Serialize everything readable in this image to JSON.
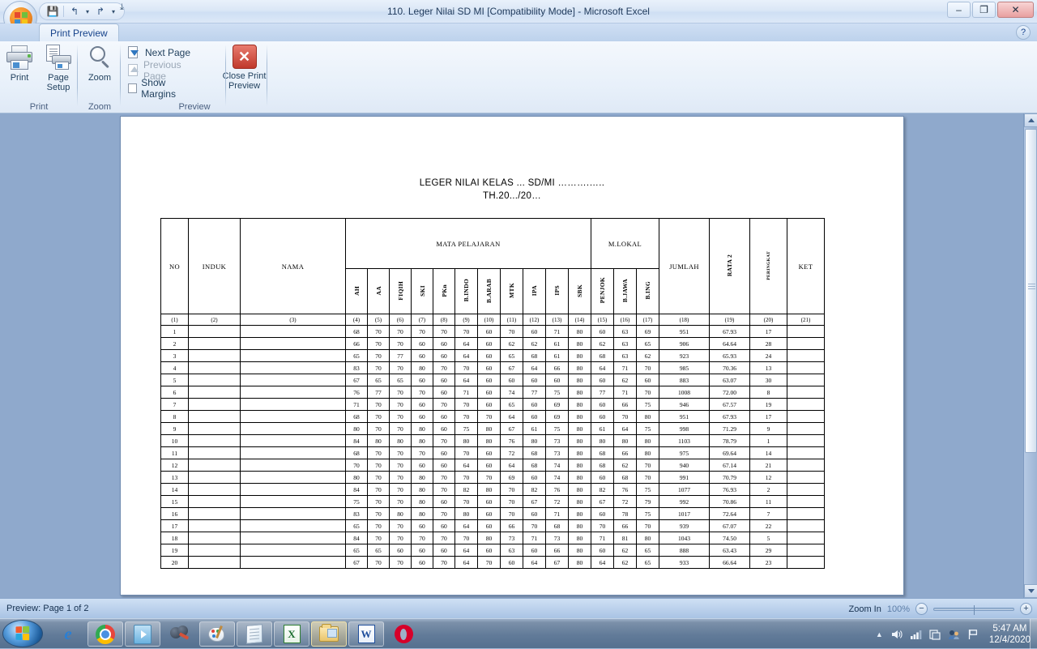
{
  "window": {
    "title": "110. Leger Nilai SD MI  [Compatibility Mode] - Microsoft Excel",
    "minimize": "–",
    "maximize": "❐",
    "close": "✕",
    "help": "?"
  },
  "quick_access": {
    "save_icon": "save-icon",
    "undo_icon": "undo-icon",
    "redo_icon": "redo-icon",
    "customize_icon": "customize-icon",
    "save_glyph": "💾",
    "undo_glyph": "↰",
    "redo_glyph": "↱",
    "dropdown_glyph": "▾",
    "more_glyph": "⤓"
  },
  "ribbon": {
    "tab": "Print Preview",
    "groups": [
      {
        "name": "Print",
        "label": "Print",
        "buttons": [
          {
            "label": "Print",
            "icon": "printer-icon"
          },
          {
            "label": "Page\nSetup",
            "label_line1": "Page",
            "label_line2": "Setup",
            "icon": "page-setup-icon"
          }
        ]
      },
      {
        "name": "Zoom",
        "label": "Zoom",
        "buttons": [
          {
            "label": "Zoom",
            "icon": "magnifier-icon"
          }
        ]
      },
      {
        "name": "Preview",
        "label": "Preview",
        "items": [
          {
            "label": "Next Page",
            "icon": "next-page-icon",
            "enabled": true
          },
          {
            "label": "Previous Page",
            "icon": "previous-page-icon",
            "enabled": false
          },
          {
            "label": "Show Margins",
            "icon": "checkbox-icon",
            "checked": false
          }
        ],
        "close_button": {
          "label_line1": "Close Print",
          "label_line2": "Preview",
          "icon": "close-x-icon",
          "glyph": "✕"
        }
      }
    ]
  },
  "document": {
    "title_line1": "LEGER NILAI KELAS ... SD/MI ……….…..",
    "title_line2": "TH.20.../20…",
    "table": {
      "group_headers": {
        "no": "NO",
        "induk": "INDUK",
        "nama": "NAMA",
        "mata_pelajaran": "MATA PELAJARAN",
        "m_lokal": "M.LOKAL",
        "jumlah": "JUMLAH",
        "rata2": "RATA 2",
        "peringkat": "PERINGKAT",
        "ket": "KET"
      },
      "subject_headers": [
        "AH",
        "AA",
        "FIQIH",
        "SKI",
        "PKn",
        "B.INDO",
        "B.ARAB",
        "MTK",
        "IPA",
        "IPS",
        "SBK"
      ],
      "local_headers": [
        "PENJOK",
        "B.JAWA",
        "B.ING"
      ],
      "number_row": [
        "(1)",
        "(2)",
        "(3)",
        "(4)",
        "(5)",
        "(6)",
        "(7)",
        "(8)",
        "(9)",
        "(10)",
        "(11)",
        "(12)",
        "(13)",
        "(14)",
        "(15)",
        "(16)",
        "(17)",
        "(18)",
        "(19)",
        "(20)",
        "(21)"
      ],
      "rows": [
        {
          "no": "1",
          "induk": "",
          "nama": "",
          "scores": [
            "68",
            "70",
            "70",
            "70",
            "70",
            "70",
            "60",
            "70",
            "60",
            "71",
            "80",
            "60",
            "63",
            "69"
          ],
          "jumlah": "951",
          "rata2": "67.93",
          "peringkat": "17",
          "ket": ""
        },
        {
          "no": "2",
          "induk": "",
          "nama": "",
          "scores": [
            "66",
            "70",
            "70",
            "60",
            "60",
            "64",
            "60",
            "62",
            "62",
            "61",
            "80",
            "62",
            "63",
            "65"
          ],
          "jumlah": "906",
          "rata2": "64.64",
          "peringkat": "28",
          "ket": ""
        },
        {
          "no": "3",
          "induk": "",
          "nama": "",
          "scores": [
            "65",
            "70",
            "77",
            "60",
            "60",
            "64",
            "60",
            "65",
            "68",
            "61",
            "80",
            "68",
            "63",
            "62"
          ],
          "jumlah": "923",
          "rata2": "65.93",
          "peringkat": "24",
          "ket": ""
        },
        {
          "no": "4",
          "induk": "",
          "nama": "",
          "scores": [
            "83",
            "70",
            "70",
            "80",
            "70",
            "70",
            "60",
            "67",
            "64",
            "66",
            "80",
            "64",
            "71",
            "70"
          ],
          "jumlah": "985",
          "rata2": "70.36",
          "peringkat": "13",
          "ket": ""
        },
        {
          "no": "5",
          "induk": "",
          "nama": "",
          "scores": [
            "67",
            "65",
            "65",
            "60",
            "60",
            "64",
            "60",
            "60",
            "60",
            "60",
            "80",
            "60",
            "62",
            "60"
          ],
          "jumlah": "883",
          "rata2": "63.07",
          "peringkat": "30",
          "ket": ""
        },
        {
          "no": "6",
          "induk": "",
          "nama": "",
          "scores": [
            "76",
            "77",
            "70",
            "70",
            "60",
            "71",
            "60",
            "74",
            "77",
            "75",
            "80",
            "77",
            "71",
            "70"
          ],
          "jumlah": "1008",
          "rata2": "72.00",
          "peringkat": "8",
          "ket": ""
        },
        {
          "no": "7",
          "induk": "",
          "nama": "",
          "scores": [
            "71",
            "70",
            "70",
            "60",
            "70",
            "70",
            "60",
            "65",
            "60",
            "69",
            "80",
            "60",
            "66",
            "75"
          ],
          "jumlah": "946",
          "rata2": "67.57",
          "peringkat": "19",
          "ket": ""
        },
        {
          "no": "8",
          "induk": "",
          "nama": "",
          "scores": [
            "68",
            "70",
            "70",
            "60",
            "60",
            "70",
            "70",
            "64",
            "60",
            "69",
            "80",
            "60",
            "70",
            "80"
          ],
          "jumlah": "951",
          "rata2": "67.93",
          "peringkat": "17",
          "ket": ""
        },
        {
          "no": "9",
          "induk": "",
          "nama": "",
          "scores": [
            "80",
            "70",
            "70",
            "80",
            "60",
            "75",
            "80",
            "67",
            "61",
            "75",
            "80",
            "61",
            "64",
            "75"
          ],
          "jumlah": "998",
          "rata2": "71.29",
          "peringkat": "9",
          "ket": ""
        },
        {
          "no": "10",
          "induk": "",
          "nama": "",
          "scores": [
            "84",
            "80",
            "80",
            "80",
            "70",
            "80",
            "80",
            "76",
            "80",
            "73",
            "80",
            "80",
            "80",
            "80"
          ],
          "jumlah": "1103",
          "rata2": "78.79",
          "peringkat": "1",
          "ket": ""
        },
        {
          "no": "11",
          "induk": "",
          "nama": "",
          "scores": [
            "68",
            "70",
            "70",
            "70",
            "60",
            "70",
            "60",
            "72",
            "68",
            "73",
            "80",
            "68",
            "66",
            "80"
          ],
          "jumlah": "975",
          "rata2": "69.64",
          "peringkat": "14",
          "ket": ""
        },
        {
          "no": "12",
          "induk": "",
          "nama": "",
          "scores": [
            "70",
            "70",
            "70",
            "60",
            "60",
            "64",
            "60",
            "64",
            "68",
            "74",
            "80",
            "68",
            "62",
            "70"
          ],
          "jumlah": "940",
          "rata2": "67.14",
          "peringkat": "21",
          "ket": ""
        },
        {
          "no": "13",
          "induk": "",
          "nama": "",
          "scores": [
            "80",
            "70",
            "70",
            "80",
            "70",
            "70",
            "70",
            "69",
            "60",
            "74",
            "80",
            "60",
            "68",
            "70"
          ],
          "jumlah": "991",
          "rata2": "70.79",
          "peringkat": "12",
          "ket": ""
        },
        {
          "no": "14",
          "induk": "",
          "nama": "",
          "scores": [
            "84",
            "70",
            "70",
            "80",
            "70",
            "82",
            "80",
            "70",
            "82",
            "76",
            "80",
            "82",
            "76",
            "75"
          ],
          "jumlah": "1077",
          "rata2": "76.93",
          "peringkat": "2",
          "ket": ""
        },
        {
          "no": "15",
          "induk": "",
          "nama": "",
          "scores": [
            "75",
            "70",
            "70",
            "80",
            "60",
            "70",
            "60",
            "70",
            "67",
            "72",
            "80",
            "67",
            "72",
            "79"
          ],
          "jumlah": "992",
          "rata2": "70.86",
          "peringkat": "11",
          "ket": ""
        },
        {
          "no": "16",
          "induk": "",
          "nama": "",
          "scores": [
            "83",
            "70",
            "80",
            "80",
            "70",
            "80",
            "60",
            "70",
            "60",
            "71",
            "80",
            "60",
            "78",
            "75"
          ],
          "jumlah": "1017",
          "rata2": "72.64",
          "peringkat": "7",
          "ket": ""
        },
        {
          "no": "17",
          "induk": "",
          "nama": "",
          "scores": [
            "65",
            "70",
            "70",
            "60",
            "60",
            "64",
            "60",
            "66",
            "70",
            "68",
            "80",
            "70",
            "66",
            "70"
          ],
          "jumlah": "939",
          "rata2": "67.07",
          "peringkat": "22",
          "ket": ""
        },
        {
          "no": "18",
          "induk": "",
          "nama": "",
          "scores": [
            "84",
            "70",
            "70",
            "70",
            "70",
            "70",
            "80",
            "73",
            "71",
            "73",
            "80",
            "71",
            "81",
            "80"
          ],
          "jumlah": "1043",
          "rata2": "74.50",
          "peringkat": "5",
          "ket": ""
        },
        {
          "no": "19",
          "induk": "",
          "nama": "",
          "scores": [
            "65",
            "65",
            "60",
            "60",
            "60",
            "64",
            "60",
            "63",
            "60",
            "66",
            "80",
            "60",
            "62",
            "65"
          ],
          "jumlah": "888",
          "rata2": "63.43",
          "peringkat": "29",
          "ket": ""
        },
        {
          "no": "20",
          "induk": "",
          "nama": "",
          "scores": [
            "67",
            "70",
            "70",
            "60",
            "70",
            "64",
            "70",
            "60",
            "64",
            "67",
            "80",
            "64",
            "62",
            "65"
          ],
          "jumlah": "933",
          "rata2": "66.64",
          "peringkat": "23",
          "ket": ""
        }
      ]
    }
  },
  "statusbar": {
    "preview_status": "Preview: Page 1 of 2",
    "zoom_label": "Zoom In",
    "zoom_level": "100%",
    "zoom_out_glyph": "−",
    "zoom_in_glyph": "+"
  },
  "taskbar": {
    "start_name": "start-button",
    "items": [
      {
        "name": "internet-explorer",
        "label": "Internet Explorer",
        "style": "plain"
      },
      {
        "name": "google-chrome",
        "label": "Google Chrome",
        "style": "framed"
      },
      {
        "name": "windows-media-player",
        "label": "Windows Media Player",
        "style": "framed"
      },
      {
        "name": "movie-maker",
        "label": "Movie Maker",
        "style": "plain"
      },
      {
        "name": "paint",
        "label": "Paint",
        "style": "framed"
      },
      {
        "name": "notepad",
        "label": "Notepad",
        "style": "framed"
      },
      {
        "name": "excel",
        "label": "Microsoft Excel",
        "style": "framed"
      },
      {
        "name": "file-explorer",
        "label": "File Explorer",
        "style": "active"
      },
      {
        "name": "word",
        "label": "Microsoft Word",
        "style": "framed"
      },
      {
        "name": "opera",
        "label": "Opera",
        "style": "plain"
      }
    ],
    "tray": {
      "show_hidden_glyph": "▲",
      "volume_glyph": "🔊",
      "network_glyph": "▂▄▆",
      "action_glyph": "🗗",
      "user_glyph": "👥",
      "flag_glyph": "⚑",
      "time": "5:47 AM",
      "date": "12/4/2020"
    }
  },
  "colors": {
    "titlebar": "#dbe7f6",
    "ribbon": "#e6eff9",
    "preview_bg": "#8fa9cc",
    "accent": "#15428b",
    "close_red": "#c0392b"
  }
}
